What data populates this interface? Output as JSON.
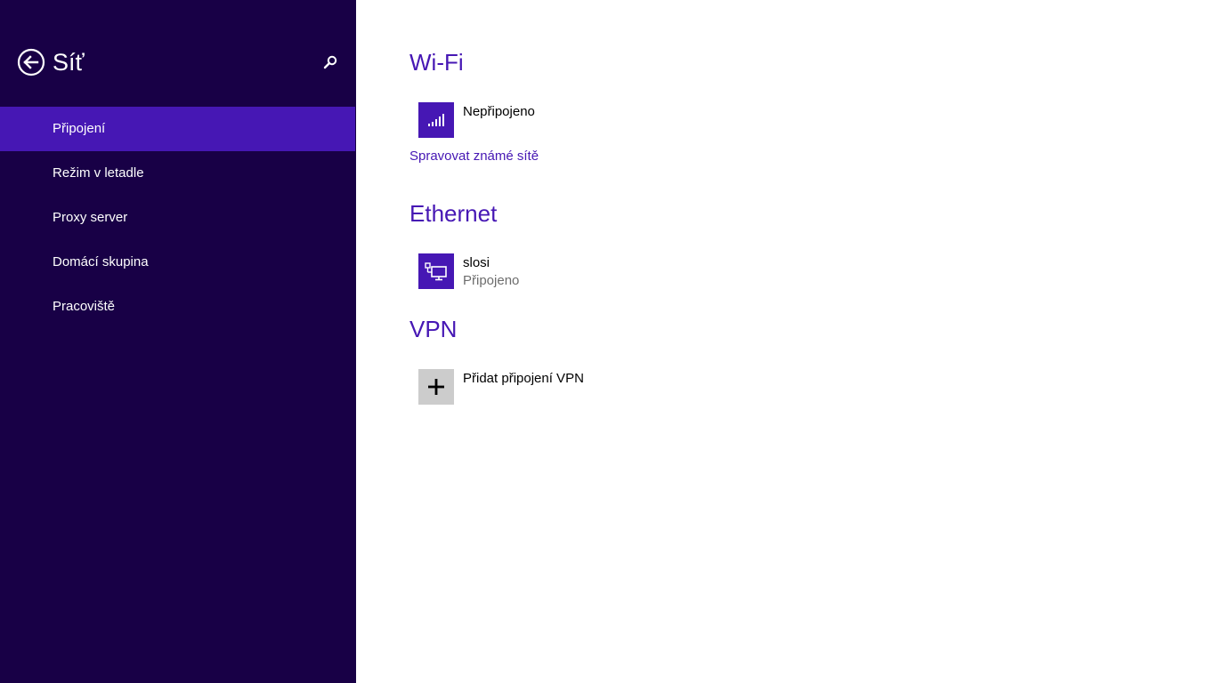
{
  "sidebar": {
    "title": "Síť",
    "back_icon": "back-arrow-circle-icon",
    "search_icon": "search-icon",
    "items": [
      {
        "label": "Připojení",
        "active": true
      },
      {
        "label": "Režim v letadle",
        "active": false
      },
      {
        "label": "Proxy server",
        "active": false
      },
      {
        "label": "Domácí skupina",
        "active": false
      },
      {
        "label": "Pracoviště",
        "active": false
      }
    ]
  },
  "main": {
    "wifi": {
      "title": "Wi-Fi",
      "status": "Nepřipojeno",
      "icon": "wifi-signal-icon",
      "manage_link": "Spravovat známé sítě"
    },
    "ethernet": {
      "title": "Ethernet",
      "name": "slosi",
      "status": "Připojeno",
      "icon": "ethernet-network-icon"
    },
    "vpn": {
      "title": "VPN",
      "add_label": "Přidat připojení VPN",
      "icon": "plus-icon"
    }
  },
  "colors": {
    "sidebar_bg": "#180046",
    "accent": "#4617b4",
    "secondary_text": "#6d6d6d",
    "tile_gray": "#cccccc"
  }
}
